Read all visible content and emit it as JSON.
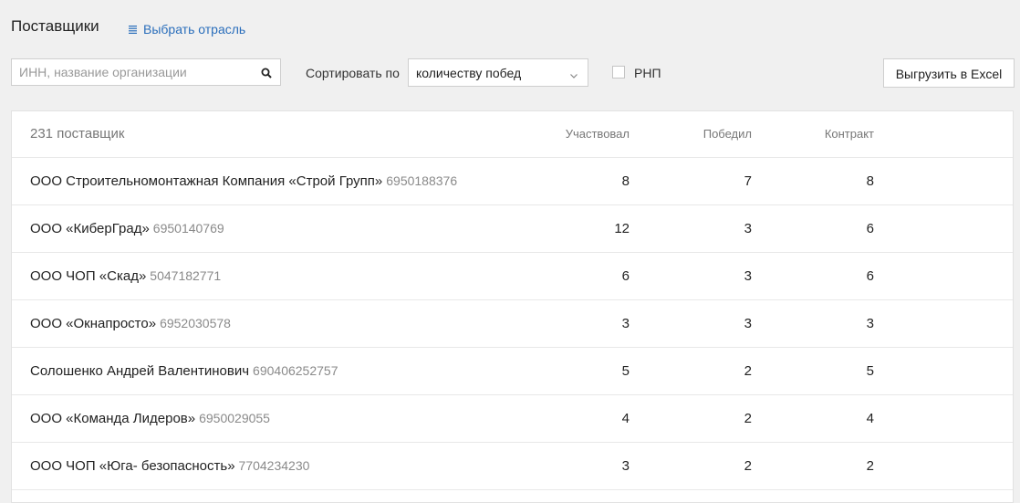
{
  "header": {
    "title": "Поставщики",
    "industry_link": "Выбрать отрасль",
    "industry_icon": "list-icon"
  },
  "filters": {
    "search_placeholder": "ИНН, название организации",
    "search_value": "",
    "search_icon": "search-icon",
    "sort_label": "Сортировать по",
    "sort_selected": "количеству побед",
    "rnp_label": "РНП",
    "rnp_checked": false,
    "export_label": "Выгрузить в Excel"
  },
  "table": {
    "count_label": "231 поставщик",
    "columns": [
      "Участвовал",
      "Победил",
      "Контракт"
    ],
    "rows": [
      {
        "name": "ООО Строительномонтажная Компания «Строй Групп»",
        "inn": "6950188376",
        "participated": "8",
        "won": "7",
        "contract": "8"
      },
      {
        "name": "ООО «КиберГрад»",
        "inn": "6950140769",
        "participated": "12",
        "won": "3",
        "contract": "6"
      },
      {
        "name": "ООО ЧОП «Скад»",
        "inn": "5047182771",
        "participated": "6",
        "won": "3",
        "contract": "6"
      },
      {
        "name": "ООО «Окнапросто»",
        "inn": "6952030578",
        "participated": "3",
        "won": "3",
        "contract": "3"
      },
      {
        "name": "Солошенко Андрей Валентинович",
        "inn": "690406252757",
        "participated": "5",
        "won": "2",
        "contract": "5"
      },
      {
        "name": "ООО «Команда Лидеров»",
        "inn": "6950029055",
        "participated": "4",
        "won": "2",
        "contract": "4"
      },
      {
        "name": "ООО ЧОП «Юга- безопасность»",
        "inn": "7704234230",
        "participated": "3",
        "won": "2",
        "contract": "2"
      }
    ]
  },
  "colors": {
    "background": "#f0f0f0",
    "link": "#2a6ebb",
    "muted_text": "#8a8a8a"
  }
}
